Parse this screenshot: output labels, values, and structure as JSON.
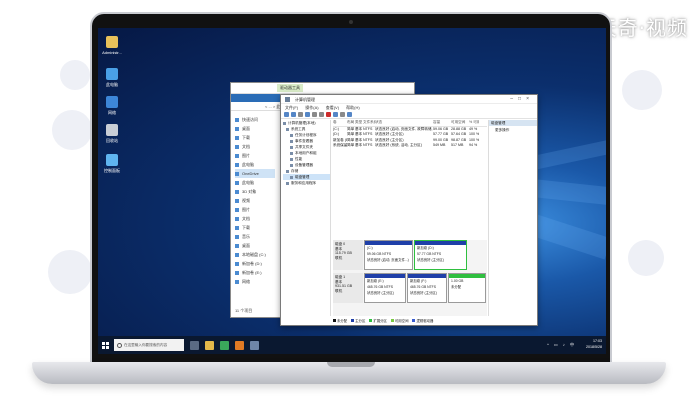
{
  "watermark": "天奇·视频",
  "desktop": {
    "icons": [
      {
        "name": "user-folder",
        "label": "Administr..."
      },
      {
        "name": "this-pc",
        "label": "此电脑"
      },
      {
        "name": "network",
        "label": "网络"
      },
      {
        "name": "recycle-bin",
        "label": "回收站"
      },
      {
        "name": "control-panel",
        "label": "控制面板"
      }
    ]
  },
  "explorer": {
    "tab_label": "驱动器工具",
    "address": "< ... > 此电脑",
    "nav_items": [
      "快速访问",
      "桌面",
      "下载",
      "文档",
      "图片",
      "此电脑",
      "OneDrive",
      "此电脑",
      "3D 对象",
      "视频",
      "图片",
      "文档",
      "下载",
      "音乐",
      "桌面",
      "本地磁盘 (C:)",
      "新加卷 (D:)",
      "新加卷 (E:)",
      "网络"
    ],
    "status": "11 个项目"
  },
  "disk_management": {
    "title": "计算机管理",
    "menu": [
      "文件(F)",
      "操作(A)",
      "查看(V)",
      "帮助(H)"
    ],
    "tree": [
      "计算机管理(本地)",
      "系统工具",
      "任务计划程序",
      "事件查看器",
      "共享文件夹",
      "本地用户和组",
      "性能",
      "设备管理器",
      "存储",
      "磁盘管理",
      "服务和应用程序"
    ],
    "list_header": [
      "卷",
      "布局",
      "类型",
      "文件系统",
      "状态",
      "容量",
      "可用空间",
      "% 可用"
    ],
    "list_rows": [
      [
        "(C:)",
        "简单",
        "基本",
        "NTFS",
        "状态良好 (启动, 页面文件, 故障转储, 主分区)",
        "59.06 GB",
        "28.88 GB",
        "49 %"
      ],
      [
        "(D:)",
        "简单",
        "基本",
        "NTFS",
        "状态良好 (主分区)",
        "57.77 GB",
        "57.64 GB",
        "100 %"
      ],
      [
        "新加卷 (E:)",
        "简单",
        "基本",
        "NTFS",
        "状态良好 (主分区)",
        "99.00 GB",
        "98.87 GB",
        "100 %"
      ],
      [
        "系统保留",
        "简单",
        "基本",
        "NTFS",
        "状态良好 (系统, 活动, 主分区)",
        "549 MB",
        "517 MB",
        "94 %"
      ]
    ],
    "actions": {
      "header": "磁盘管理",
      "items": [
        "更多操作"
      ]
    },
    "disks": [
      {
        "label": "磁盘 0",
        "info": [
          "基本",
          "115.79 GB",
          "联机"
        ],
        "partitions": [
          {
            "name": "(C:)",
            "detail": "59.06 GB NTFS",
            "status": "状态良好 (启动, 页面文件...)",
            "color": "#1f3fa8"
          },
          {
            "name": "新加卷 (D:)",
            "detail": "57.77 GB NTFS",
            "status": "状态良好 (主分区)",
            "color": "#1f3fa8"
          }
        ]
      },
      {
        "label": "磁盘 1",
        "info": [
          "基本",
          "931.51 GB",
          "联机"
        ],
        "partitions": [
          {
            "name": "新加卷 (E:)",
            "detail": "465.76 GB NTFS",
            "status": "状态良好 (主分区)",
            "color": "#1f3fa8"
          },
          {
            "name": "新加卷 (F:)",
            "detail": "465.76 GB NTFS",
            "status": "状态良好 (主分区)",
            "color": "#1f3fa8"
          },
          {
            "name": "",
            "detail": "1.00 GB",
            "status": "未分配",
            "color": "#2fbf3f"
          }
        ]
      }
    ],
    "legend": [
      {
        "label": "未分配",
        "color": "#111111"
      },
      {
        "label": "主分区",
        "color": "#1f3fa8"
      },
      {
        "label": "扩展分区",
        "color": "#2fbf3f"
      },
      {
        "label": "可用空间",
        "color": "#7ac943"
      },
      {
        "label": "逻辑驱动器",
        "color": "#3a5ccf"
      }
    ]
  },
  "taskbar": {
    "search_placeholder": "在这里输入你要搜索的内容",
    "time": "17:03",
    "date": "2018/5/28"
  }
}
